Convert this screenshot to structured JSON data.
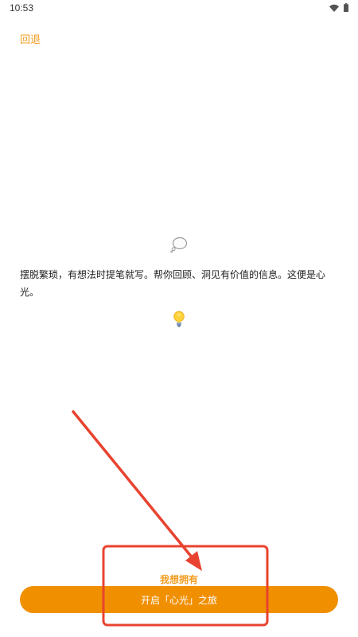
{
  "status_bar": {
    "time": "10:53"
  },
  "header": {
    "back_label": "回退"
  },
  "main": {
    "intro_text": "摆脱繁琐，有想法时提笔就写。帮你回顾、洞见有价值的信息。这便是心光。",
    "icons": [
      "speech-bubble-icon",
      "light-bulb-icon"
    ]
  },
  "footer": {
    "want_label": "我想拥有",
    "start_label": "开启「心光」之旅"
  },
  "colors": {
    "accent": "#f29c1f",
    "button": "#f08f00",
    "annotation": "#e8432f"
  }
}
